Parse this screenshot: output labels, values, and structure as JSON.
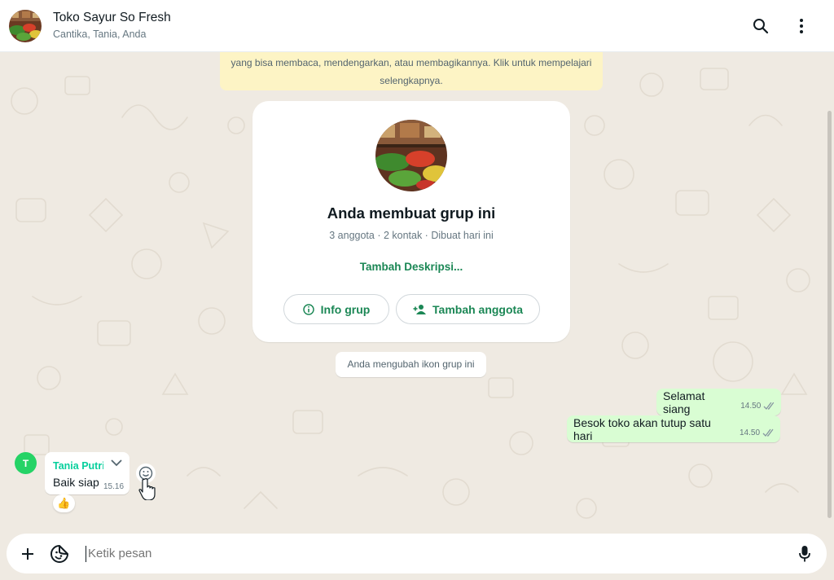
{
  "header": {
    "title": "Toko Sayur So Fresh",
    "subtitle": "Cantika, Tania, Anda",
    "avatar_icon": "group-photo-vegetable-market",
    "search_icon": "search-icon",
    "menu_icon": "more-vertical-icon"
  },
  "notice": {
    "text": "yang bisa membaca, mendengarkan, atau membagikannya. Klik untuk mempelajari selengkapnya."
  },
  "group_card": {
    "title": "Anda membuat grup ini",
    "meta": "3 anggota · 2 kontak · Dibuat hari ini",
    "description_link": "Tambah Deskripsi...",
    "info_button": "Info grup",
    "add_member_button": "Tambah anggota",
    "accent_color": "#1b8755"
  },
  "system_message": {
    "text": "Anda mengubah ikon grup ini"
  },
  "messages": [
    {
      "direction": "out",
      "text": "Selamat siang",
      "time": "14.50",
      "status": "read"
    },
    {
      "direction": "out",
      "text": "Besok toko akan tutup satu hari",
      "time": "14.50",
      "status": "read"
    },
    {
      "direction": "in",
      "sender": "Tania Putri",
      "sender_initial": "T",
      "text": "Baik siap",
      "time": "15.16",
      "reaction": "👍"
    }
  ],
  "composer": {
    "placeholder": "Ketik pesan",
    "attach_icon": "plus-icon",
    "sticker_icon": "sticker-icon",
    "mic_icon": "microphone-icon"
  },
  "colors": {
    "outgoing_bubble": "#d9fdd3",
    "chat_background": "#efeae2",
    "notice_background": "#fdf4c5",
    "sender_name": "#06cf9c"
  }
}
